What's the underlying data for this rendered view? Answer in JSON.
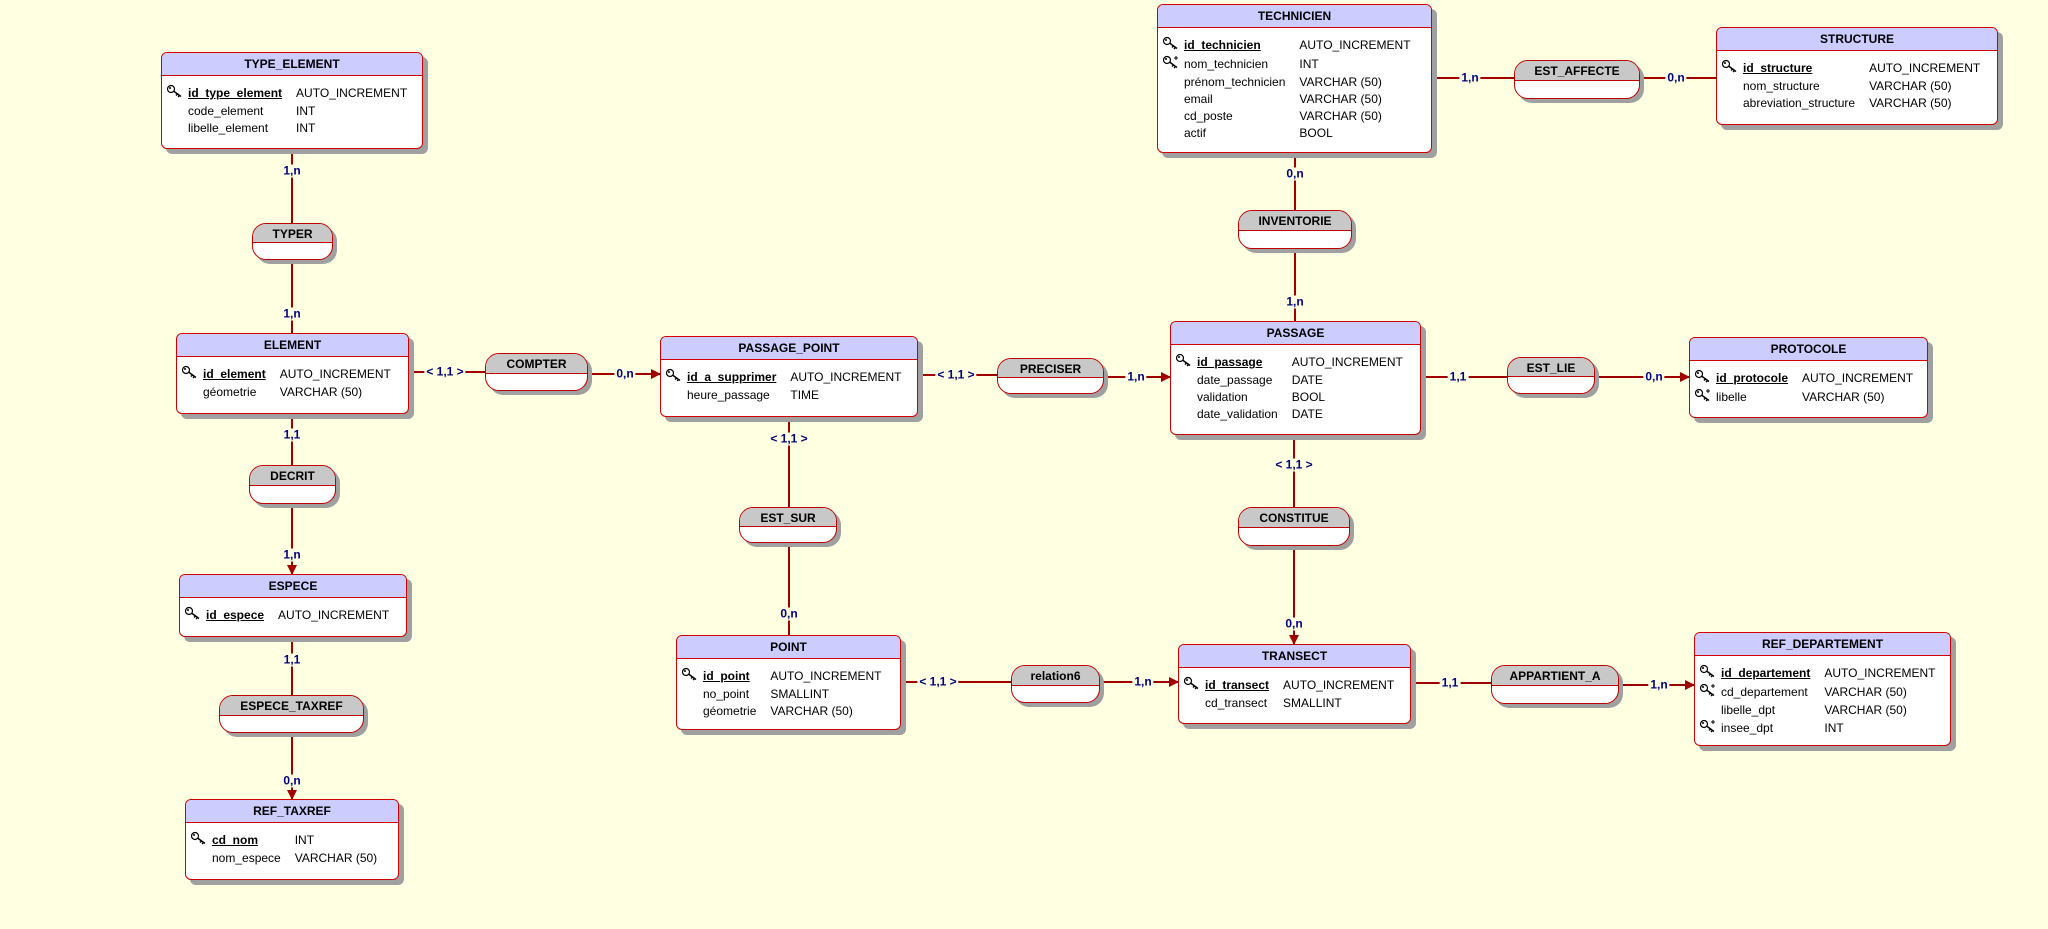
{
  "colors": {
    "background": "#ffffe1",
    "entity_header": "#ccccff",
    "association_header": "#c8c8c8",
    "border": "#d00000",
    "cardinality": "#000080"
  },
  "entities": [
    {
      "name": "TYPE_ELEMENT",
      "rows": [
        {
          "icon": "primary-key-icon",
          "field": "id_type_element",
          "type": "AUTO_INCREMENT",
          "pk": true
        },
        {
          "icon": "",
          "field": "code_element",
          "type": "INT"
        },
        {
          "icon": "",
          "field": "libelle_element",
          "type": "INT"
        }
      ]
    },
    {
      "name": "ELEMENT",
      "rows": [
        {
          "icon": "primary-key-icon",
          "field": "id_element",
          "type": "AUTO_INCREMENT",
          "pk": true
        },
        {
          "icon": "",
          "field": "géometrie",
          "type": "VARCHAR (50)"
        }
      ]
    },
    {
      "name": "ESPECE",
      "rows": [
        {
          "icon": "primary-key-icon",
          "field": "id_espece",
          "type": "AUTO_INCREMENT",
          "pk": true
        }
      ]
    },
    {
      "name": "REF_TAXREF",
      "rows": [
        {
          "icon": "primary-key-icon",
          "field": "cd_nom",
          "type": "INT",
          "pk": true
        },
        {
          "icon": "",
          "field": "nom_espece",
          "type": "VARCHAR (50)"
        }
      ]
    },
    {
      "name": "PASSAGE_POINT",
      "rows": [
        {
          "icon": "primary-key-icon",
          "field": "id_a_supprimer",
          "type": "AUTO_INCREMENT",
          "pk": true
        },
        {
          "icon": "",
          "field": "heure_passage",
          "type": "TIME"
        }
      ]
    },
    {
      "name": "POINT",
      "rows": [
        {
          "icon": "primary-key-icon",
          "field": "id_point",
          "type": "AUTO_INCREMENT",
          "pk": true
        },
        {
          "icon": "",
          "field": "no_point",
          "type": "SMALLINT"
        },
        {
          "icon": "",
          "field": "géometrie",
          "type": "VARCHAR (50)"
        }
      ]
    },
    {
      "name": "TECHNICIEN",
      "rows": [
        {
          "icon": "primary-key-icon",
          "field": "id_technicien",
          "type": "AUTO_INCREMENT",
          "pk": true
        },
        {
          "icon": "unique-key-icon",
          "field": "nom_technicien",
          "type": "INT"
        },
        {
          "icon": "",
          "field": "prénom_technicien",
          "type": "VARCHAR (50)"
        },
        {
          "icon": "",
          "field": "email",
          "type": "VARCHAR (50)"
        },
        {
          "icon": "",
          "field": "cd_poste",
          "type": "VARCHAR (50)"
        },
        {
          "icon": "",
          "field": "actif",
          "type": "BOOL"
        }
      ]
    },
    {
      "name": "STRUCTURE",
      "rows": [
        {
          "icon": "primary-key-icon",
          "field": "id_structure",
          "type": "AUTO_INCREMENT",
          "pk": true
        },
        {
          "icon": "",
          "field": "nom_structure",
          "type": "VARCHAR (50)"
        },
        {
          "icon": "",
          "field": "abreviation_structure",
          "type": "VARCHAR (50)"
        }
      ]
    },
    {
      "name": "PASSAGE",
      "rows": [
        {
          "icon": "primary-key-icon",
          "field": "id_passage",
          "type": "AUTO_INCREMENT",
          "pk": true
        },
        {
          "icon": "",
          "field": "date_passage",
          "type": "DATE"
        },
        {
          "icon": "",
          "field": "validation",
          "type": "BOOL"
        },
        {
          "icon": "",
          "field": "date_validation",
          "type": "DATE"
        }
      ]
    },
    {
      "name": "PROTOCOLE",
      "rows": [
        {
          "icon": "primary-key-icon",
          "field": "id_protocole",
          "type": "AUTO_INCREMENT",
          "pk": true
        },
        {
          "icon": "unique-key-icon",
          "field": "libelle",
          "type": "VARCHAR (50)"
        }
      ]
    },
    {
      "name": "TRANSECT",
      "rows": [
        {
          "icon": "primary-key-icon",
          "field": "id_transect",
          "type": "AUTO_INCREMENT",
          "pk": true
        },
        {
          "icon": "",
          "field": "cd_transect",
          "type": "SMALLINT"
        }
      ]
    },
    {
      "name": "REF_DEPARTEMENT",
      "rows": [
        {
          "icon": "primary-key-icon",
          "field": "id_departement",
          "type": "AUTO_INCREMENT",
          "pk": true
        },
        {
          "icon": "unique-key-icon",
          "field": "cd_departement",
          "type": "VARCHAR (50)"
        },
        {
          "icon": "",
          "field": "libelle_dpt",
          "type": "VARCHAR (50)"
        },
        {
          "icon": "unique-key-icon",
          "field": "insee_dpt",
          "type": "INT"
        }
      ]
    }
  ],
  "associations": [
    "TYPER",
    "DECRIT",
    "ESPECE_TAXREF",
    "COMPTER",
    "EST_SUR",
    "PRECISER",
    "relation6",
    "INVENTORIE",
    "CONSTITUE",
    "EST_LIE",
    "EST_AFFECTE",
    "APPARTIENT_A"
  ],
  "links": [
    {
      "from": "TYPE_ELEMENT",
      "to": "TYPER",
      "cardinality": "1,n",
      "arrow": false
    },
    {
      "from": "TYPER",
      "to": "ELEMENT",
      "cardinality": "1,n",
      "arrow": false
    },
    {
      "from": "ELEMENT",
      "to": "DECRIT",
      "cardinality": "1,1",
      "arrow": false
    },
    {
      "from": "DECRIT",
      "to": "ESPECE",
      "cardinality": "1,n",
      "arrow": true
    },
    {
      "from": "ESPECE",
      "to": "ESPECE_TAXREF",
      "cardinality": "1,1",
      "arrow": false
    },
    {
      "from": "ESPECE_TAXREF",
      "to": "REF_TAXREF",
      "cardinality": "0,n",
      "arrow": true
    },
    {
      "from": "ELEMENT",
      "to": "COMPTER",
      "cardinality": "< 1,1 >",
      "arrow": false
    },
    {
      "from": "COMPTER",
      "to": "PASSAGE_POINT",
      "cardinality": "0,n",
      "arrow": true
    },
    {
      "from": "PASSAGE_POINT",
      "to": "PRECISER",
      "cardinality": "< 1,1 >",
      "arrow": false
    },
    {
      "from": "PRECISER",
      "to": "PASSAGE",
      "cardinality": "1,n",
      "arrow": true
    },
    {
      "from": "PASSAGE_POINT",
      "to": "EST_SUR",
      "cardinality": "< 1,1 >",
      "arrow": false
    },
    {
      "from": "EST_SUR",
      "to": "POINT",
      "cardinality": "0,n",
      "arrow": false
    },
    {
      "from": "POINT",
      "to": "relation6",
      "cardinality": "< 1,1 >",
      "arrow": false
    },
    {
      "from": "relation6",
      "to": "TRANSECT",
      "cardinality": "1,n",
      "arrow": true
    },
    {
      "from": "TECHNICIEN",
      "to": "INVENTORIE",
      "cardinality": "0,n",
      "arrow": false
    },
    {
      "from": "INVENTORIE",
      "to": "PASSAGE",
      "cardinality": "1,n",
      "arrow": false
    },
    {
      "from": "PASSAGE",
      "to": "CONSTITUE",
      "cardinality": "< 1,1 >",
      "arrow": false
    },
    {
      "from": "CONSTITUE",
      "to": "TRANSECT",
      "cardinality": "0,n",
      "arrow": true
    },
    {
      "from": "TECHNICIEN",
      "to": "EST_AFFECTE",
      "cardinality": "1,n",
      "arrow": false
    },
    {
      "from": "EST_AFFECTE",
      "to": "STRUCTURE",
      "cardinality": "0,n",
      "arrow": false
    },
    {
      "from": "PASSAGE",
      "to": "EST_LIE",
      "cardinality": "1,1",
      "arrow": false
    },
    {
      "from": "EST_LIE",
      "to": "PROTOCOLE",
      "cardinality": "0,n",
      "arrow": true
    },
    {
      "from": "TRANSECT",
      "to": "APPARTIENT_A",
      "cardinality": "1,1",
      "arrow": false
    },
    {
      "from": "APPARTIENT_A",
      "to": "REF_DEPARTEMENT",
      "cardinality": "1,n",
      "arrow": true
    }
  ]
}
